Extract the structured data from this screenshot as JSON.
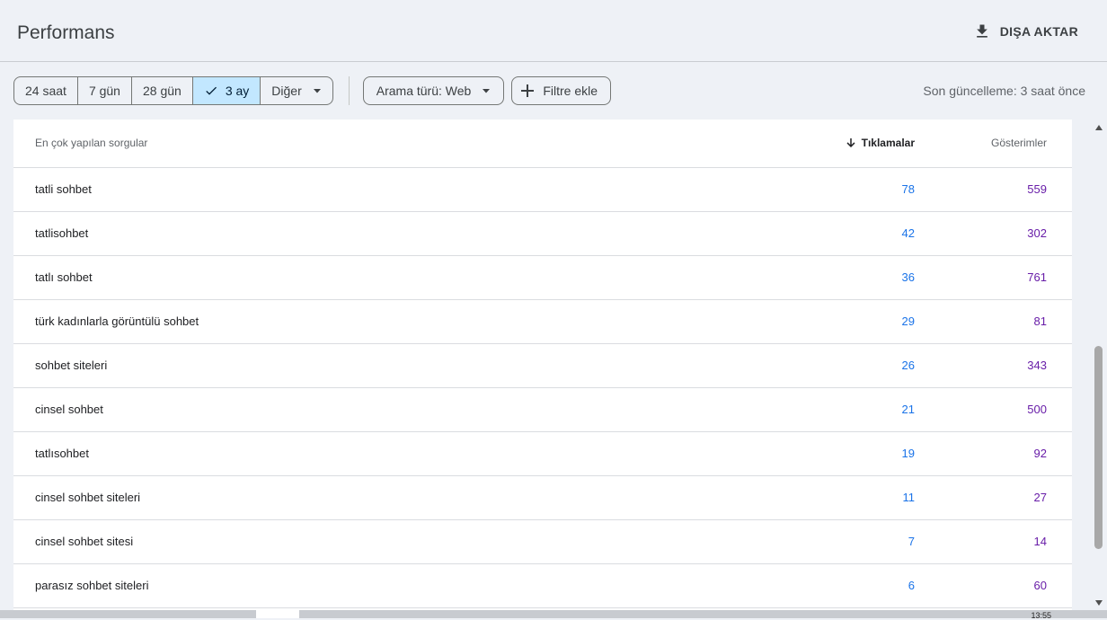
{
  "header": {
    "title": "Performans",
    "export_label": "DIŞA AKTAR"
  },
  "filters": {
    "date_range": [
      {
        "label": "24 saat",
        "selected": false
      },
      {
        "label": "7 gün",
        "selected": false
      },
      {
        "label": "28 gün",
        "selected": false
      },
      {
        "label": "3 ay",
        "selected": true
      },
      {
        "label": "Diğer",
        "selected": false
      }
    ],
    "search_type_label": "Arama türü: Web",
    "add_filter_label": "Filtre ekle",
    "last_update": "Son güncelleme: 3 saat önce"
  },
  "table": {
    "columns": {
      "query": "En çok yapılan sorgular",
      "clicks": "Tıklamalar",
      "impressions": "Gösterimler"
    },
    "rows": [
      {
        "query": "tatli sohbet",
        "clicks": "78",
        "impressions": "559"
      },
      {
        "query": "tatlisohbet",
        "clicks": "42",
        "impressions": "302"
      },
      {
        "query": "tatlı sohbet",
        "clicks": "36",
        "impressions": "761"
      },
      {
        "query": "türk kadınlarla görüntülü sohbet",
        "clicks": "29",
        "impressions": "81"
      },
      {
        "query": "sohbet siteleri",
        "clicks": "26",
        "impressions": "343"
      },
      {
        "query": "cinsel sohbet",
        "clicks": "21",
        "impressions": "500"
      },
      {
        "query": "tatlısohbet",
        "clicks": "19",
        "impressions": "92"
      },
      {
        "query": "cinsel sohbet siteleri",
        "clicks": "11",
        "impressions": "27"
      },
      {
        "query": "cinsel sohbet sitesi",
        "clicks": "7",
        "impressions": "14"
      },
      {
        "query": "parasız sohbet siteleri",
        "clicks": "6",
        "impressions": "60"
      }
    ]
  },
  "taskbar": {
    "time": "13:55"
  },
  "icons": {
    "export": "download-icon",
    "selected": "check-icon",
    "dropdown": "caret-down-icon",
    "add": "plus-icon",
    "sort": "arrow-down-icon"
  },
  "colors": {
    "clicks": "#1a73e8",
    "impressions": "#681da8",
    "selected_chip": "#c2e7ff"
  }
}
